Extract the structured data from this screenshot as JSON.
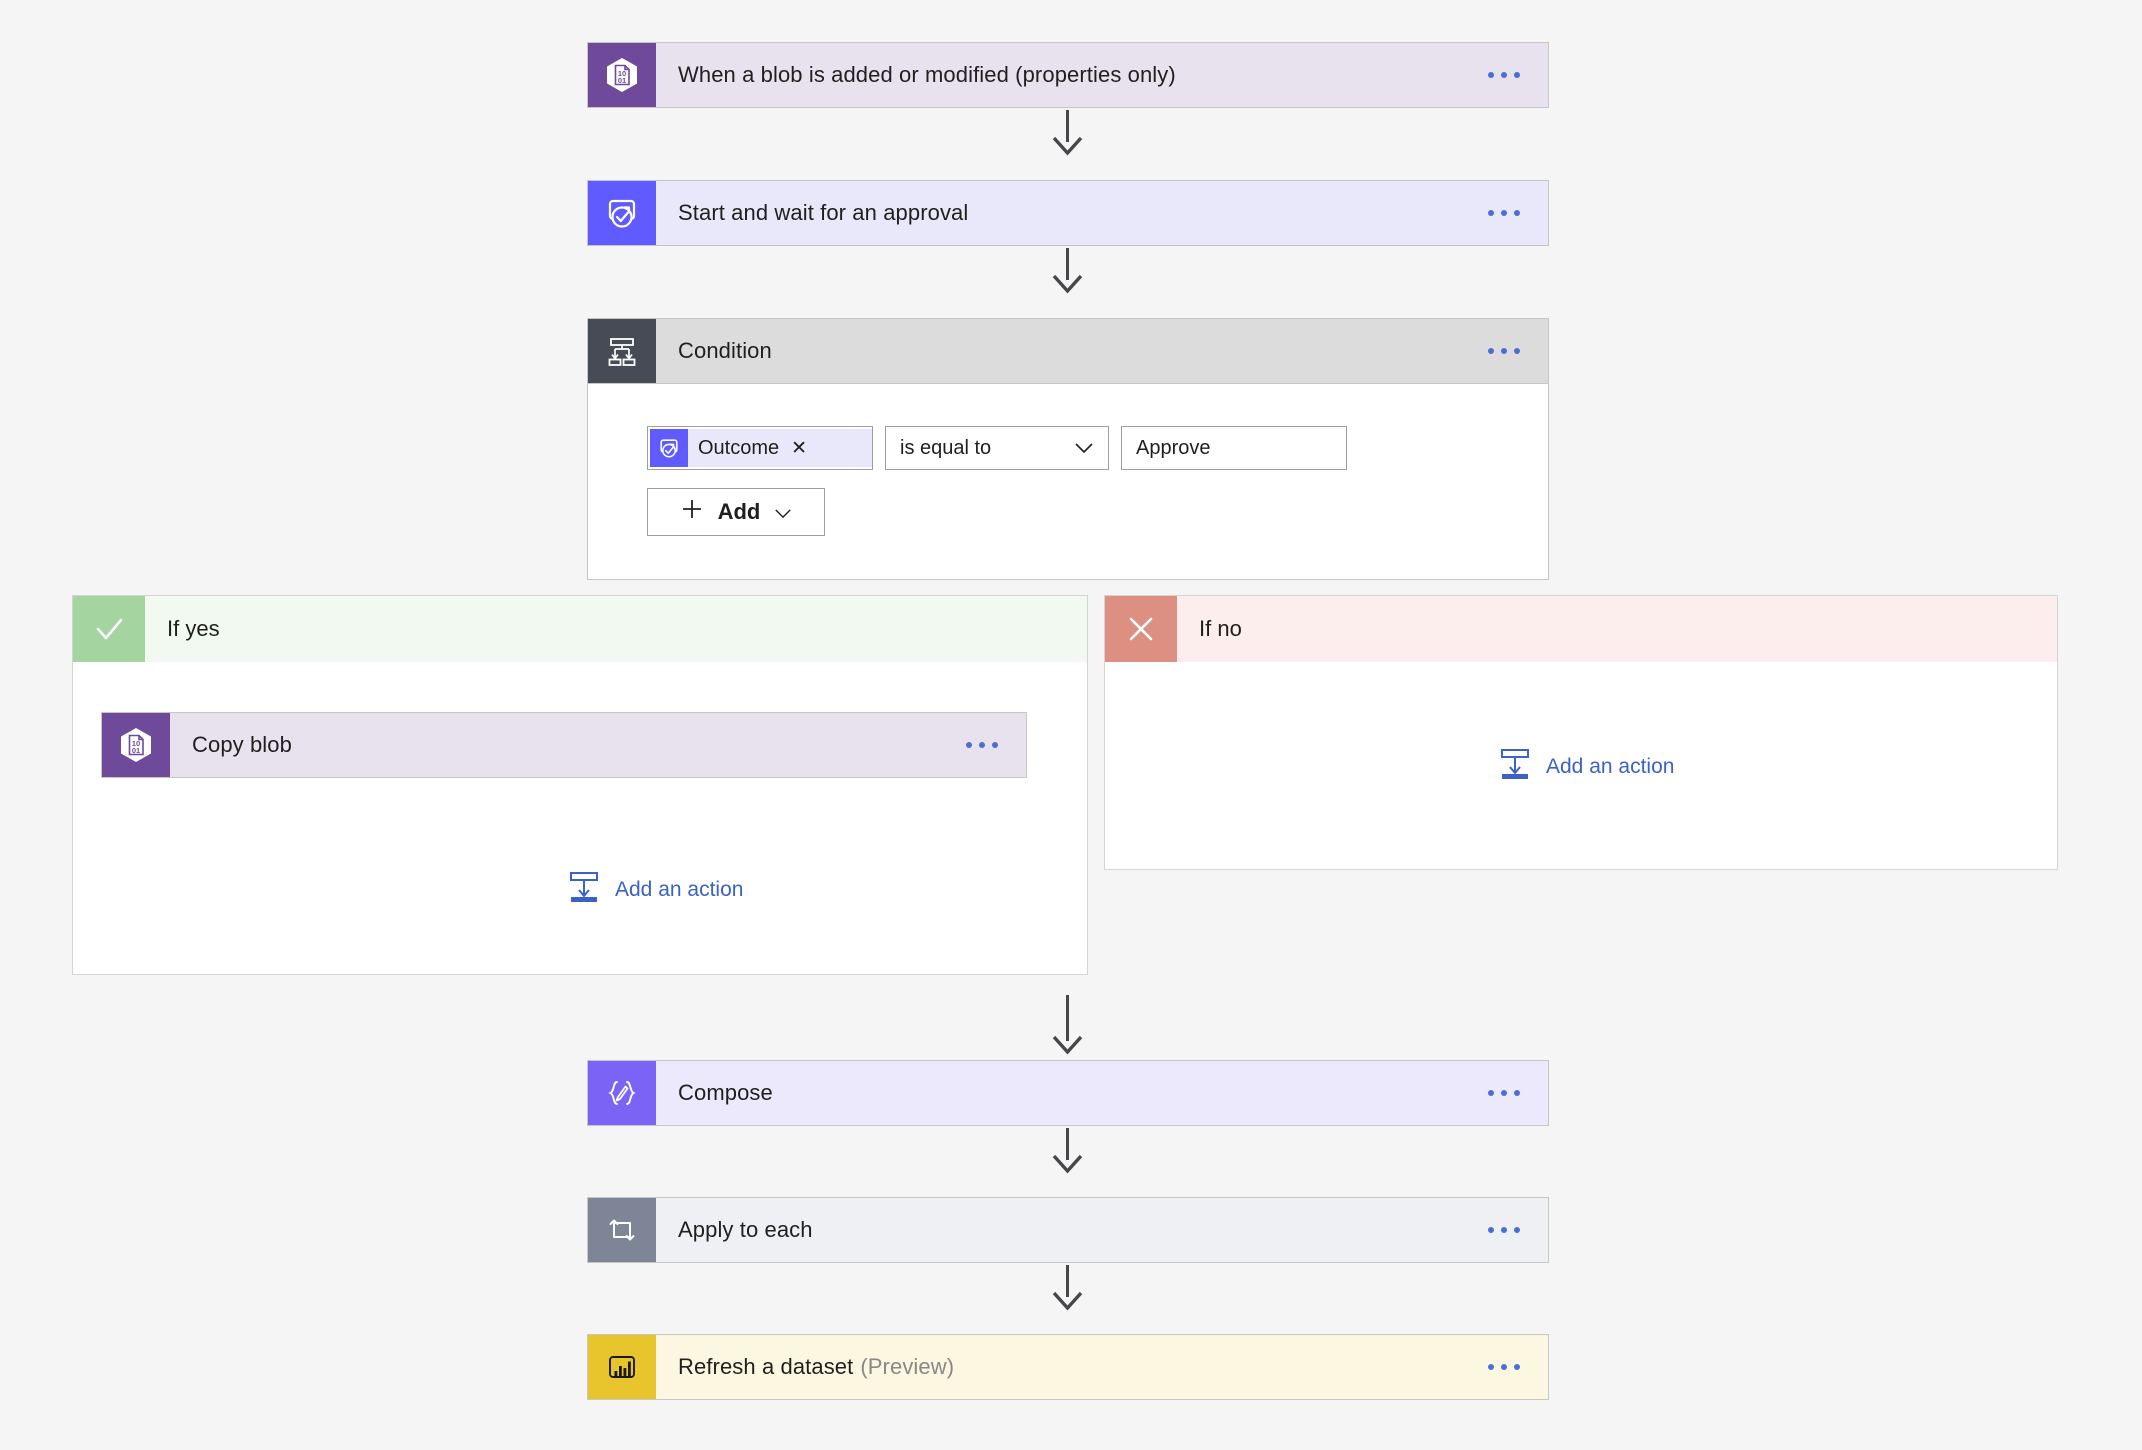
{
  "flow": {
    "nodes": [
      {
        "id": "trigger-blob",
        "label": "When a blob is added or modified (properties only)",
        "icon": "azure-blob-icon",
        "menu": "more-commands"
      },
      {
        "id": "approval",
        "label": "Start and wait for an approval",
        "icon": "approvals-icon",
        "menu": "more-commands"
      },
      {
        "id": "condition",
        "label": "Condition",
        "icon": "condition-icon",
        "menu": "more-commands"
      },
      {
        "id": "compose",
        "label": "Compose",
        "icon": "compose-icon",
        "menu": "more-commands"
      },
      {
        "id": "apply-to-each",
        "label": "Apply to each",
        "icon": "loop-icon",
        "menu": "more-commands"
      },
      {
        "id": "refresh-dataset",
        "label": "Refresh a dataset",
        "suffix": "(Preview)",
        "icon": "power-bi-icon",
        "menu": "more-commands"
      }
    ],
    "condition": {
      "token_label": "Outcome",
      "token_remove": "✕",
      "operator": "is equal to",
      "value": "Approve",
      "add_label": "Add",
      "add_plus": "+"
    },
    "branches": {
      "yes": {
        "label": "If yes",
        "icon": "checkmark-icon",
        "action": {
          "label": "Copy blob",
          "icon": "azure-blob-icon"
        },
        "add_action": "Add an action"
      },
      "no": {
        "label": "If no",
        "icon": "cross-icon",
        "add_action": "Add an action"
      }
    },
    "colors": {
      "canvas": "#f5f5f5",
      "blob_purple": "#6f4a9b",
      "blob_body": "#e8e2ef",
      "approval_indigo": "#605bff",
      "approval_body": "#e9e8fb",
      "condition_slate": "#474b56",
      "condition_body": "#dcdcdc",
      "compose_purple": "#7a63f5",
      "compose_body": "#ece9fd",
      "loop_slate": "#7d8596",
      "loop_body": "#eef0f3",
      "powerbi_yellow": "#e8c52c",
      "powerbi_body": "#fcf7e0",
      "yes_green": "#a4d4a0",
      "no_red": "#dd8f82",
      "link_blue": "#3b62c4"
    }
  }
}
